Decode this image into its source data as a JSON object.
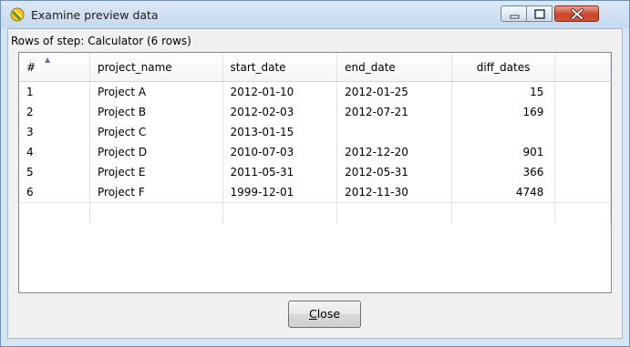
{
  "window": {
    "title": "Examine preview data"
  },
  "rows_label": "Rows of step: Calculator (6 rows)",
  "table": {
    "columns": [
      "#",
      "project_name",
      "start_date",
      "end_date",
      "diff_dates"
    ],
    "rows": [
      [
        "1",
        "Project A",
        "2012-01-10",
        "2012-01-25",
        "15"
      ],
      [
        "2",
        "Project B",
        "2012-02-03",
        "2012-07-21",
        "169"
      ],
      [
        "3",
        "Project C",
        "2013-01-15",
        "",
        ""
      ],
      [
        "4",
        "Project D",
        "2010-07-03",
        "2012-12-20",
        "901"
      ],
      [
        "5",
        "Project E",
        "2011-05-31",
        "2012-05-31",
        "366"
      ],
      [
        "6",
        "Project F",
        "1999-12-01",
        "2012-11-30",
        "4748"
      ]
    ]
  },
  "buttons": {
    "close_access_key": "C",
    "close_rest": "lose"
  }
}
